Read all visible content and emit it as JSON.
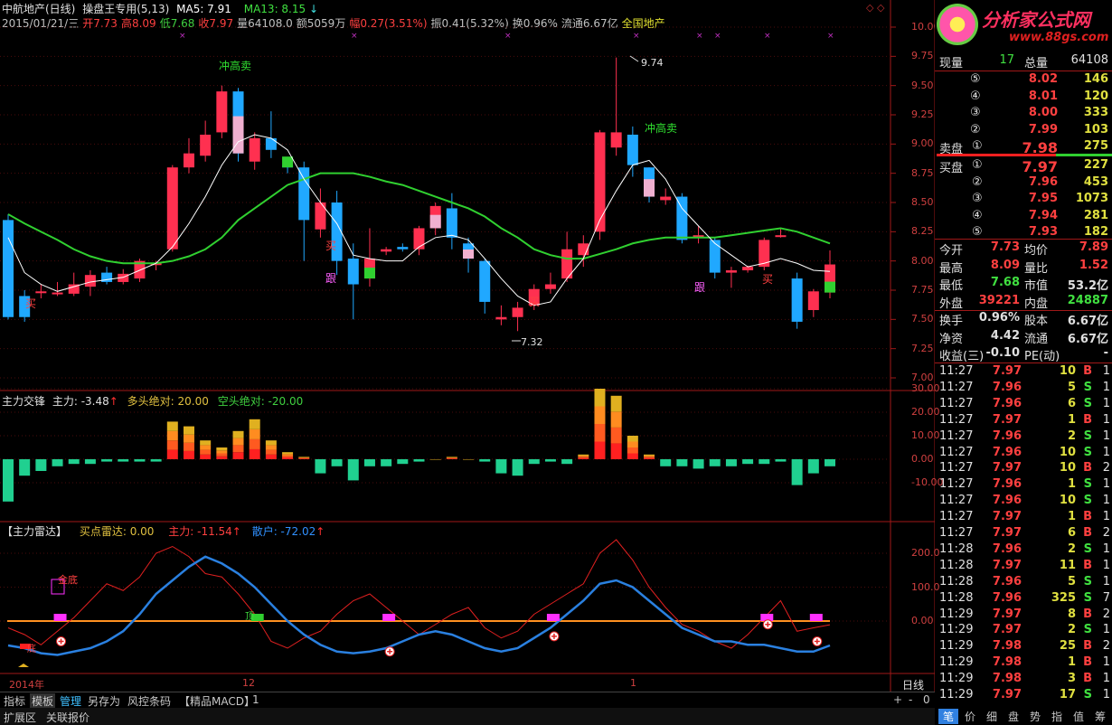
{
  "header": {
    "stock": "中航地产(日线)",
    "system": "操盘王专用(5,13)",
    "ma5_label": "MA5: 7.91",
    "ma13_label": "MA13: 8.15",
    "line2": [
      {
        "t": "2015/01/21/三",
        "c": "#c0c0c0"
      },
      {
        "t": "开7.73",
        "c": "#ff4040"
      },
      {
        "t": "高8.09",
        "c": "#ff4040"
      },
      {
        "t": "低7.68",
        "c": "#40d040"
      },
      {
        "t": "收7.97",
        "c": "#ff4040"
      },
      {
        "t": "量64108.0",
        "c": "#c0c0c0"
      },
      {
        "t": "额5059万",
        "c": "#c0c0c0"
      },
      {
        "t": "幅0.27(3.51%)",
        "c": "#ff4040"
      },
      {
        "t": "振0.41(5.32%)",
        "c": "#c0c0c0"
      },
      {
        "t": "换0.96%",
        "c": "#c0c0c0"
      },
      {
        "t": "流通6.67亿",
        "c": "#c0c0c0"
      },
      {
        "t": "全国地产",
        "c": "#e0e030"
      }
    ]
  },
  "logo": {
    "title": "分析家公式网",
    "url": "www.88gs.com"
  },
  "main_axis": [
    "10.00",
    "9.75",
    "9.50",
    "9.25",
    "9.00",
    "8.75",
    "8.50",
    "8.25",
    "8.00",
    "7.75",
    "7.50",
    "7.25",
    "7.00"
  ],
  "annotations": {
    "high1": "冲高卖",
    "high2": "冲高卖",
    "buy": "买",
    "follow": "跟",
    "peak": "9.74",
    "trough": "7.32"
  },
  "ind1": {
    "title": "主力交锋",
    "main": "主力: -3.48",
    "bull": "多头绝对: 20.00",
    "bear": "空头绝对: -20.00",
    "axis": [
      "30.00",
      "20.00",
      "10.00",
      "0.00",
      "-10.00"
    ]
  },
  "ind2": {
    "title": "【主力雷达】",
    "buy": "买点雷达: 0.00",
    "main": "主力: -11.54",
    "retail": "散户: -72.02",
    "axis": [
      "200.0",
      "100.0",
      "0.00"
    ],
    "label_bottom": "金底",
    "label_top": "顶",
    "label_small": "底"
  },
  "time_axis": {
    "y2014": "2014年",
    "m12": "12",
    "m1": "1",
    "period": "日线",
    "zoom_plus": "+",
    "zoom_minus": "-",
    "zoom_val": "0"
  },
  "tabs": [
    "指标",
    "模板",
    "管理",
    "另存为",
    "风控条码",
    "【精品MACD】",
    "1"
  ],
  "bottom_tabs": [
    "扩展区",
    "关联报价"
  ],
  "quote": {
    "now_label": "现量",
    "now_val": "17",
    "total_label": "总量",
    "total_val": "64108",
    "sell": [
      {
        "lv": "⑤",
        "p": "8.02",
        "v": "146"
      },
      {
        "lv": "④",
        "p": "8.01",
        "v": "120"
      },
      {
        "lv": "③",
        "p": "8.00",
        "v": "333"
      },
      {
        "lv": "②",
        "p": "7.99",
        "v": "103"
      },
      {
        "lv": "①",
        "p": "7.98",
        "v": "275"
      }
    ],
    "sell_label": "卖盘",
    "buy_label": "买盘",
    "buy": [
      {
        "lv": "①",
        "p": "7.97",
        "v": "227"
      },
      {
        "lv": "②",
        "p": "7.96",
        "v": "453"
      },
      {
        "lv": "③",
        "p": "7.95",
        "v": "1073"
      },
      {
        "lv": "④",
        "p": "7.94",
        "v": "281"
      },
      {
        "lv": "⑤",
        "p": "7.93",
        "v": "182"
      }
    ],
    "stats": [
      {
        "l1": "今开",
        "v1": "7.73",
        "c1": "#ff4040",
        "l2": "均价",
        "v2": "7.89",
        "c2": "#ff4040"
      },
      {
        "l1": "最高",
        "v1": "8.09",
        "c1": "#ff4040",
        "l2": "量比",
        "v2": "1.52",
        "c2": "#ff4040"
      },
      {
        "l1": "最低",
        "v1": "7.68",
        "c1": "#40e040",
        "l2": "市值",
        "v2": "53.2亿",
        "c2": "#e0e0e0"
      },
      {
        "l1": "外盘",
        "v1": "39221",
        "c1": "#ff4040",
        "l2": "内盘",
        "v2": "24887",
        "c2": "#40e040"
      },
      {
        "l1": "换手",
        "v1": "0.96%",
        "c1": "#e0e0e0",
        "l2": "股本",
        "v2": "6.67亿",
        "c2": "#e0e0e0"
      },
      {
        "l1": "净资",
        "v1": "4.42",
        "c1": "#e0e0e0",
        "l2": "流通",
        "v2": "6.67亿",
        "c2": "#e0e0e0"
      },
      {
        "l1": "收益(三)",
        "v1": "-0.10",
        "c1": "#e0e0e0",
        "l2": "PE(动)",
        "v2": "-",
        "c2": "#e0e0e0"
      }
    ],
    "ticks": [
      {
        "t": "11:27",
        "p": "7.97",
        "v": "10",
        "s": "B",
        "n": "1"
      },
      {
        "t": "11:27",
        "p": "7.96",
        "v": "5",
        "s": "S",
        "n": "1"
      },
      {
        "t": "11:27",
        "p": "7.96",
        "v": "6",
        "s": "S",
        "n": "1"
      },
      {
        "t": "11:27",
        "p": "7.97",
        "v": "1",
        "s": "B",
        "n": "1"
      },
      {
        "t": "11:27",
        "p": "7.96",
        "v": "2",
        "s": "S",
        "n": "1"
      },
      {
        "t": "11:27",
        "p": "7.96",
        "v": "10",
        "s": "S",
        "n": "1"
      },
      {
        "t": "11:27",
        "p": "7.97",
        "v": "10",
        "s": "B",
        "n": "2"
      },
      {
        "t": "11:27",
        "p": "7.96",
        "v": "1",
        "s": "S",
        "n": "1"
      },
      {
        "t": "11:27",
        "p": "7.96",
        "v": "10",
        "s": "S",
        "n": "1"
      },
      {
        "t": "11:27",
        "p": "7.97",
        "v": "1",
        "s": "B",
        "n": "1"
      },
      {
        "t": "11:27",
        "p": "7.97",
        "v": "6",
        "s": "B",
        "n": "2"
      },
      {
        "t": "11:28",
        "p": "7.96",
        "v": "2",
        "s": "S",
        "n": "1"
      },
      {
        "t": "11:28",
        "p": "7.97",
        "v": "11",
        "s": "B",
        "n": "1"
      },
      {
        "t": "11:28",
        "p": "7.96",
        "v": "5",
        "s": "S",
        "n": "1"
      },
      {
        "t": "11:28",
        "p": "7.96",
        "v": "325",
        "s": "S",
        "n": "7"
      },
      {
        "t": "11:29",
        "p": "7.97",
        "v": "8",
        "s": "B",
        "n": "2"
      },
      {
        "t": "11:29",
        "p": "7.97",
        "v": "2",
        "s": "S",
        "n": "1"
      },
      {
        "t": "11:29",
        "p": "7.98",
        "v": "25",
        "s": "B",
        "n": "2"
      },
      {
        "t": "11:29",
        "p": "7.98",
        "v": "1",
        "s": "B",
        "n": "1"
      },
      {
        "t": "11:29",
        "p": "7.98",
        "v": "3",
        "s": "B",
        "n": "1"
      },
      {
        "t": "11:29",
        "p": "7.97",
        "v": "17",
        "s": "S",
        "n": "1"
      }
    ],
    "right_tabs": [
      "笔",
      "价",
      "细",
      "盘",
      "势",
      "指",
      "值",
      "筹"
    ]
  },
  "chart_data": {
    "type": "candlestick",
    "candles": [
      [
        8.35,
        7.52,
        8.4,
        7.5
      ],
      [
        7.7,
        7.52,
        7.75,
        7.48
      ],
      [
        7.73,
        7.74,
        7.8,
        7.68
      ],
      [
        7.72,
        7.73,
        7.82,
        7.7
      ],
      [
        7.72,
        7.8,
        7.9,
        7.7
      ],
      [
        7.78,
        7.88,
        7.92,
        7.7
      ],
      [
        7.9,
        7.82,
        7.95,
        7.8
      ],
      [
        7.82,
        7.89,
        7.93,
        7.8
      ],
      [
        7.85,
        8.0,
        8.02,
        7.82
      ],
      [
        7.98,
        7.98,
        8.0,
        7.92
      ],
      [
        8.1,
        8.8,
        8.82,
        8.08
      ],
      [
        8.8,
        8.92,
        9.05,
        8.75
      ],
      [
        8.9,
        9.08,
        9.2,
        8.85
      ],
      [
        9.1,
        9.45,
        9.5,
        9.05
      ],
      [
        9.45,
        8.92,
        9.48,
        8.85
      ],
      [
        8.85,
        9.05,
        9.1,
        8.78
      ],
      [
        9.05,
        8.95,
        9.28,
        8.88
      ],
      [
        8.82,
        8.8,
        8.85,
        8.75
      ],
      [
        8.8,
        8.35,
        8.85,
        8.0
      ],
      [
        8.27,
        8.5,
        8.62,
        8.2
      ],
      [
        8.5,
        8.0,
        8.6,
        7.88
      ],
      [
        8.02,
        7.8,
        8.15,
        7.5
      ],
      [
        7.85,
        8.02,
        8.28,
        7.78
      ],
      [
        8.08,
        8.1,
        8.12,
        8.05
      ],
      [
        8.12,
        8.1,
        8.15,
        8.08
      ],
      [
        8.1,
        8.28,
        8.3,
        8.05
      ],
      [
        8.28,
        8.47,
        8.5,
        8.22
      ],
      [
        8.45,
        8.2,
        8.58,
        8.1
      ],
      [
        8.15,
        8.02,
        8.2,
        7.9
      ],
      [
        8.0,
        7.65,
        8.02,
        7.55
      ],
      [
        7.5,
        7.52,
        7.62,
        7.45
      ],
      [
        7.52,
        7.6,
        7.65,
        7.4
      ],
      [
        7.62,
        7.76,
        7.8,
        7.58
      ],
      [
        7.76,
        7.8,
        7.9,
        7.72
      ],
      [
        7.85,
        8.1,
        8.25,
        7.82
      ],
      [
        8.05,
        8.15,
        8.22,
        7.95
      ],
      [
        8.25,
        9.1,
        9.12,
        8.18
      ],
      [
        8.97,
        9.1,
        9.74,
        8.9
      ],
      [
        9.08,
        8.82,
        9.15,
        8.72
      ],
      [
        8.8,
        8.55,
        8.8,
        8.5
      ],
      [
        8.52,
        8.55,
        8.62,
        8.48
      ],
      [
        8.55,
        8.18,
        8.58,
        8.15
      ],
      [
        8.2,
        8.22,
        8.3,
        8.15
      ],
      [
        8.18,
        7.9,
        8.2,
        7.85
      ],
      [
        7.9,
        7.92,
        7.95,
        7.77
      ],
      [
        7.92,
        7.95,
        7.96,
        7.9
      ],
      [
        7.95,
        8.18,
        8.2,
        7.92
      ],
      [
        8.22,
        8.22,
        8.28,
        8.2
      ],
      [
        7.85,
        7.48,
        7.9,
        7.42
      ],
      [
        7.58,
        7.74,
        7.76,
        7.52
      ],
      [
        7.73,
        7.97,
        8.09,
        7.68
      ]
    ],
    "ma5": [
      8.2,
      7.9,
      7.8,
      7.74,
      7.78,
      7.82,
      7.84,
      7.86,
      7.92,
      7.98,
      8.12,
      8.32,
      8.55,
      8.82,
      9.02,
      9.08,
      9.05,
      8.95,
      8.7,
      8.5,
      8.32,
      8.05,
      8.02,
      8.0,
      8.0,
      8.12,
      8.2,
      8.22,
      8.18,
      8.02,
      7.85,
      7.7,
      7.62,
      7.65,
      7.85,
      8.02,
      8.35,
      8.6,
      8.82,
      8.86,
      8.7,
      8.45,
      8.3,
      8.15,
      8.05,
      7.95,
      7.98,
      8.02,
      7.98,
      7.92,
      7.91
    ],
    "ma13": [
      8.4,
      8.32,
      8.25,
      8.18,
      8.1,
      8.04,
      8.0,
      7.98,
      7.98,
      7.98,
      8.0,
      8.04,
      8.1,
      8.2,
      8.35,
      8.45,
      8.55,
      8.65,
      8.7,
      8.75,
      8.75,
      8.75,
      8.72,
      8.68,
      8.65,
      8.6,
      8.55,
      8.5,
      8.45,
      8.38,
      8.28,
      8.2,
      8.1,
      8.05,
      8.02,
      8.02,
      8.06,
      8.1,
      8.15,
      8.18,
      8.2,
      8.2,
      8.2,
      8.2,
      8.22,
      8.24,
      8.26,
      8.28,
      8.25,
      8.2,
      8.15
    ],
    "ind1": [
      -18,
      -7,
      -5,
      -3,
      -2,
      -2,
      -1,
      -1,
      -1,
      -1,
      16,
      14,
      8,
      5,
      12,
      17,
      8,
      3,
      1,
      -6,
      -3,
      -9,
      -3,
      -3,
      -2,
      -1,
      0,
      1,
      0,
      -1,
      -6,
      -7,
      -2,
      -1,
      -2,
      2,
      30,
      27,
      10,
      2,
      -3,
      -3,
      -4,
      -3,
      -3,
      -2,
      -2,
      -1,
      -11,
      -6,
      -3
    ],
    "radar_main": [
      -20,
      -40,
      -70,
      -30,
      10,
      60,
      110,
      90,
      130,
      200,
      220,
      190,
      140,
      130,
      80,
      20,
      -60,
      -80,
      -50,
      -30,
      20,
      60,
      80,
      40,
      0,
      -40,
      -10,
      20,
      40,
      -20,
      -50,
      -30,
      20,
      50,
      80,
      110,
      200,
      240,
      180,
      100,
      40,
      -10,
      -30,
      -60,
      -80,
      -40,
      10,
      60,
      -30,
      -20,
      -11
    ],
    "radar_retail": [
      -72,
      -80,
      -95,
      -100,
      -90,
      -80,
      -60,
      -30,
      20,
      80,
      120,
      160,
      190,
      170,
      140,
      100,
      50,
      0,
      -40,
      -70,
      -90,
      -95,
      -90,
      -80,
      -60,
      -40,
      -30,
      -40,
      -60,
      -80,
      -90,
      -80,
      -50,
      -20,
      20,
      60,
      110,
      120,
      100,
      60,
      20,
      -20,
      -40,
      -60,
      -60,
      -70,
      -70,
      -80,
      -90,
      -90,
      -72
    ],
    "ylim": [
      7.0,
      10.0
    ]
  }
}
